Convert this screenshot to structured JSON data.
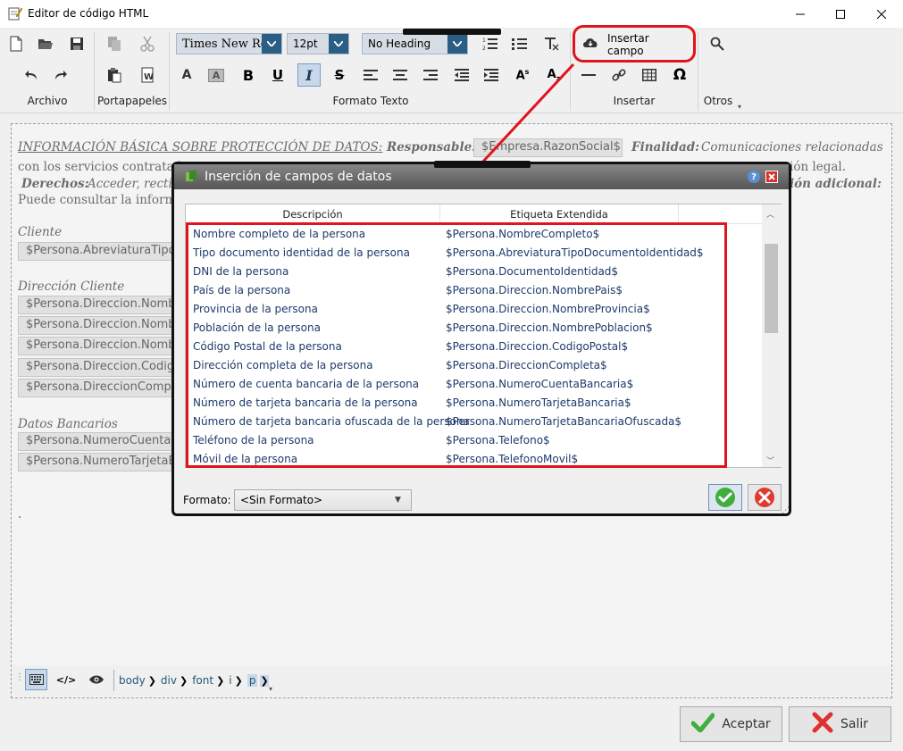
{
  "window": {
    "title": "Editor de código HTML"
  },
  "ribbon": {
    "groups": [
      "Archivo",
      "Portapapeles",
      "Formato Texto",
      "Insertar",
      "Otros"
    ],
    "font_name": "Times New Roman",
    "font_size": "12pt",
    "heading": "No Heading",
    "insert_field_label": "Insertar campo"
  },
  "editor": {
    "line1_title": "INFORMACIÓN BÁSICA SOBRE PROTECCIÓN DE DATOS:",
    "line1_resp": "Responsable:",
    "line1_field": "$Empresa.RazonSocial$",
    "line1_fin": "Finalidad:",
    "line1_fin_text": "Comunicaciones relacionadas",
    "line2_left": "con los servicios contratad",
    "line2_right": "ión legal.",
    "line3_left": "Derechos:",
    "line3_left_text": "Acceder, rectif",
    "line3_right": "ión adicional:",
    "line4": "Puede consultar la informa",
    "cliente_label": "Cliente",
    "cliente_field": "$Persona.AbreviaturaTipoD",
    "direccion_label": "Dirección Cliente",
    "direccion_fields": [
      "$Persona.Direccion.Nombr",
      "$Persona.Direccion.Nombr",
      "$Persona.Direccion.Nombr",
      "$Persona.Direccion.Codigo",
      "$Persona.DireccionComple"
    ],
    "datos_label": "Datos Bancarios",
    "datos_fields": [
      "$Persona.NumeroCuentaB",
      "$Persona.NumeroTarjetaBa"
    ],
    "dot": "."
  },
  "statusbar": {
    "crumbs": [
      "body",
      "div",
      "font",
      "i",
      "p"
    ]
  },
  "buttons": {
    "accept": "Aceptar",
    "exit": "Salir"
  },
  "dialog": {
    "title": "Inserción de campos de datos",
    "col_desc": "Descripción",
    "col_tag": "Etiqueta Extendida",
    "rows": [
      {
        "desc": "Nombre completo de la persona",
        "tag": "$Persona.NombreCompleto$"
      },
      {
        "desc": "Tipo documento identidad de la persona",
        "tag": "$Persona.AbreviaturaTipoDocumentoIdentidad$"
      },
      {
        "desc": "DNI de la persona",
        "tag": "$Persona.DocumentoIdentidad$"
      },
      {
        "desc": "País de la persona",
        "tag": "$Persona.Direccion.NombrePais$"
      },
      {
        "desc": "Provincia de la persona",
        "tag": "$Persona.Direccion.NombreProvincia$"
      },
      {
        "desc": "Población de la persona",
        "tag": "$Persona.Direccion.NombrePoblacion$"
      },
      {
        "desc": "Código Postal de la persona",
        "tag": "$Persona.Direccion.CodigoPostal$"
      },
      {
        "desc": "Dirección completa de la persona",
        "tag": "$Persona.DireccionCompleta$"
      },
      {
        "desc": "Número de cuenta bancaria de la persona",
        "tag": "$Persona.NumeroCuentaBancaria$"
      },
      {
        "desc": "Número de tarjeta bancaria de la persona",
        "tag": "$Persona.NumeroTarjetaBancaria$"
      },
      {
        "desc": "Número de tarjeta bancaria ofuscada de la persona",
        "tag": "$Persona.NumeroTarjetaBancariaOfuscada$"
      },
      {
        "desc": "Teléfono de la persona",
        "tag": "$Persona.Telefono$"
      },
      {
        "desc": "Móvil de la persona",
        "tag": "$Persona.TelefonoMovil$"
      }
    ],
    "format_label": "Formato:",
    "format_value": "<Sin Formato>"
  },
  "colors": {
    "highlight": "#e0141c",
    "accent": "#2a5e85",
    "link": "#1e3a6a"
  }
}
